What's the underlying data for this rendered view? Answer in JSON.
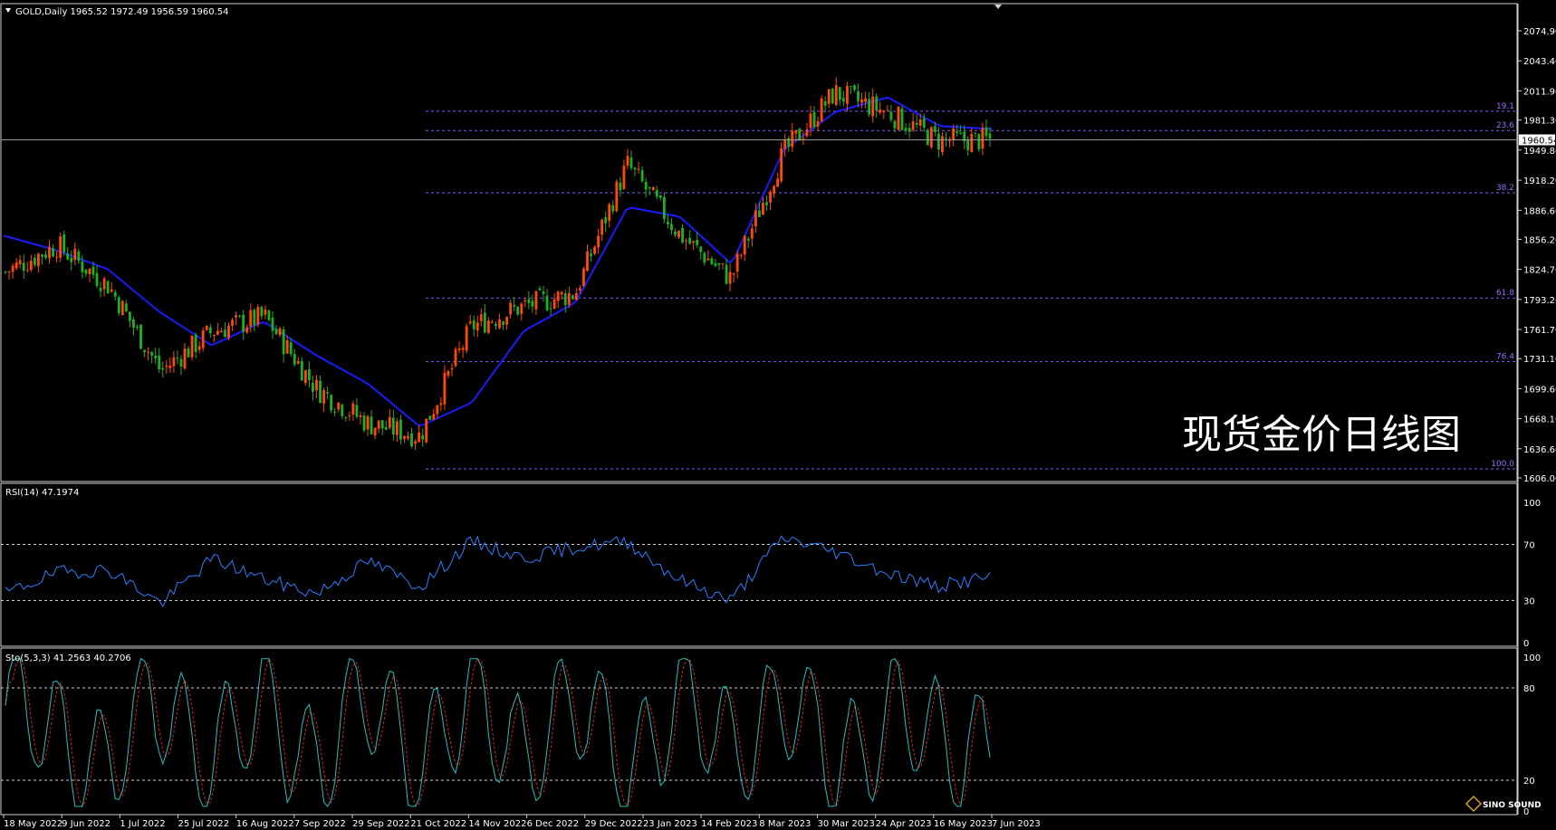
{
  "main": {
    "info": "GOLD,Daily  1965.52 1972.49 1956.59 1960.54",
    "symbol": "GOLD",
    "timeframe": "Daily",
    "ohlc": {
      "open": 1965.52,
      "high": 1972.49,
      "low": 1956.59,
      "close": 1960.54
    },
    "current_price": "1960.54",
    "watermark": "现货金价日线图",
    "price_ticks": [
      "2074.90",
      "2043.40",
      "2011.90",
      "1981.30",
      "1949.80",
      "1918.20",
      "1886.60",
      "1856.20",
      "1824.70",
      "1793.20",
      "1761.70",
      "1731.10",
      "1699.60",
      "1668.10",
      "1636.60",
      "1606.00"
    ],
    "fib_levels": [
      {
        "label": "19.1",
        "price": 1990.5
      },
      {
        "label": "23.6",
        "price": 1970.3
      },
      {
        "label": "38.2",
        "price": 1905.0
      },
      {
        "label": "61.8",
        "price": 1794.7
      },
      {
        "label": "76.4",
        "price": 1727.8
      },
      {
        "label": "100.0",
        "price": 1615.5
      }
    ]
  },
  "rsi": {
    "info": "RSI(14) 47.1974",
    "ticks": [
      "100",
      "70",
      "30",
      "0"
    ],
    "levels": [
      70,
      30
    ]
  },
  "sto": {
    "info": "Sto(5,3,3) 41.2563 40.2706",
    "ticks": [
      "100",
      "80",
      "20",
      "0"
    ],
    "levels": [
      80,
      20
    ]
  },
  "x_axis": {
    "labels": [
      "18 May 2022",
      "9 Jun 2022",
      "1 Jul 2022",
      "25 Jul 2022",
      "16 Aug 2022",
      "7 Sep 2022",
      "29 Sep 2022",
      "21 Oct 2022",
      "14 Nov 2022",
      "6 Dec 2022",
      "29 Dec 2022",
      "23 Jan 2023",
      "14 Feb 2023",
      "8 Mar 2023",
      "30 Mar 2023",
      "24 Apr 2023",
      "16 May 2023",
      "7 Jun 2023"
    ]
  },
  "logo": {
    "text": "SINO SOUND"
  },
  "colors": {
    "background": "#000000",
    "bull_candle": "#ff4a00",
    "bear_candle": "#1fb01f",
    "ma": "#1a1aff",
    "rsi_line": "#2a7fff",
    "sto_main": "#20c0c0",
    "sto_signal": "#d02020",
    "fib": "#7f5cff",
    "grid_dashed": "#cccccc"
  },
  "chart_data": [
    {
      "type": "candlestick",
      "title": "GOLD,Daily",
      "ylim": [
        1606.0,
        2090.0
      ],
      "x": [
        "18 May 2022",
        "9 Jun 2022",
        "1 Jul 2022",
        "25 Jul 2022",
        "16 Aug 2022",
        "7 Sep 2022",
        "29 Sep 2022",
        "21 Oct 2022",
        "14 Nov 2022",
        "6 Dec 2022",
        "29 Dec 2022",
        "23 Jan 2023",
        "14 Feb 2023",
        "8 Mar 2023",
        "30 Mar 2023",
        "24 Apr 2023",
        "16 May 2023",
        "7 Jun 2023"
      ],
      "series": [
        {
          "name": "close",
          "values": [
            1822,
            1850,
            1807,
            1718,
            1760,
            1775,
            1700,
            1663,
            1650,
            1765,
            1786,
            1800,
            1935,
            1862,
            1815,
            1945,
            2010,
            1990,
            1960,
            1960.54
          ]
        },
        {
          "name": "moving average",
          "values": [
            1860,
            1845,
            1825,
            1780,
            1745,
            1770,
            1735,
            1705,
            1660,
            1685,
            1760,
            1790,
            1890,
            1880,
            1830,
            1950,
            1990,
            2005,
            1975,
            1972
          ]
        }
      ]
    },
    {
      "type": "line",
      "title": "RSI(14) 47.1974",
      "ylim": [
        0,
        100
      ],
      "series": [
        {
          "name": "RSI(14)",
          "values": [
            35,
            50,
            52,
            28,
            60,
            45,
            35,
            58,
            40,
            72,
            60,
            68,
            72,
            45,
            30,
            75,
            65,
            50,
            40,
            47.2
          ]
        }
      ]
    },
    {
      "type": "line",
      "title": "Sto(5,3,3) 41.2563 40.2706",
      "ylim": [
        0,
        100
      ],
      "series": [
        {
          "name": "main",
          "values": [
            95,
            40,
            5,
            100,
            20,
            85,
            10,
            98,
            15,
            100,
            30,
            90,
            5,
            95,
            40,
            90,
            10,
            70,
            40,
            41.26
          ]
        },
        {
          "name": "signal",
          "values": [
            85,
            45,
            10,
            90,
            25,
            80,
            15,
            90,
            20,
            95,
            35,
            85,
            10,
            88,
            45,
            85,
            15,
            65,
            45,
            40.27
          ]
        }
      ]
    }
  ]
}
